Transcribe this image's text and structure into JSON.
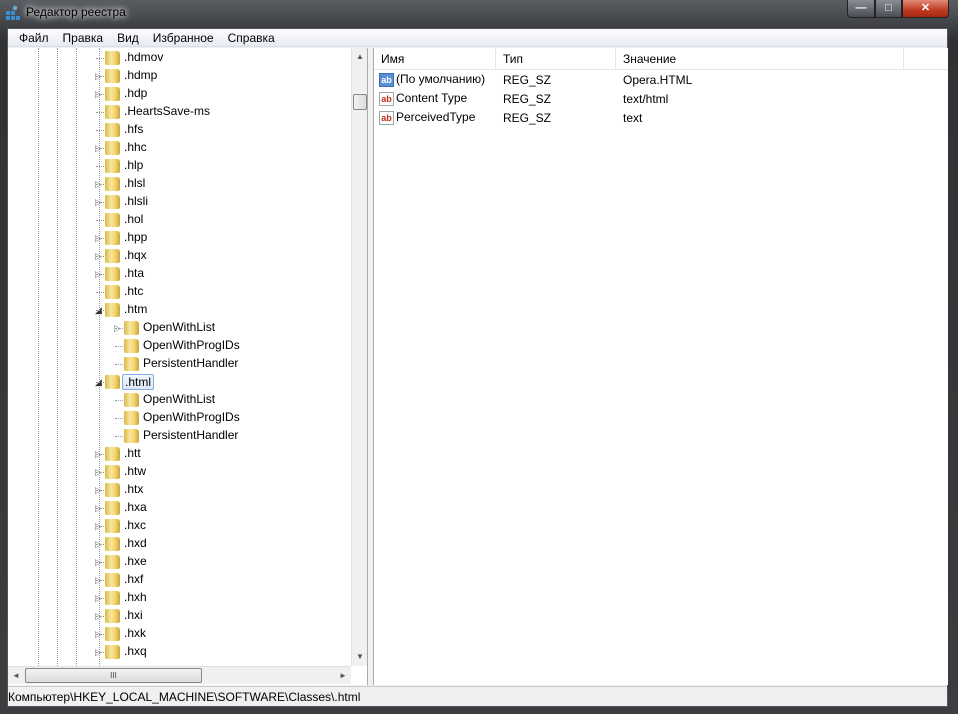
{
  "window": {
    "title": "Редактор реестра",
    "minimize": "—",
    "maximize": "□",
    "close": "✕"
  },
  "menu": [
    "Файл",
    "Правка",
    "Вид",
    "Избранное",
    "Справка"
  ],
  "tree": [
    {
      "label": ".hdmov",
      "level": 0,
      "arrow": "none"
    },
    {
      "label": ".hdmp",
      "level": 0,
      "arrow": "collapsed"
    },
    {
      "label": ".hdp",
      "level": 0,
      "arrow": "collapsed"
    },
    {
      "label": ".HeartsSave-ms",
      "level": 0,
      "arrow": "none"
    },
    {
      "label": ".hfs",
      "level": 0,
      "arrow": "none"
    },
    {
      "label": ".hhc",
      "level": 0,
      "arrow": "collapsed"
    },
    {
      "label": ".hlp",
      "level": 0,
      "arrow": "none"
    },
    {
      "label": ".hlsl",
      "level": 0,
      "arrow": "collapsed"
    },
    {
      "label": ".hlsli",
      "level": 0,
      "arrow": "collapsed"
    },
    {
      "label": ".hol",
      "level": 0,
      "arrow": "none"
    },
    {
      "label": ".hpp",
      "level": 0,
      "arrow": "collapsed"
    },
    {
      "label": ".hqx",
      "level": 0,
      "arrow": "collapsed"
    },
    {
      "label": ".hta",
      "level": 0,
      "arrow": "collapsed"
    },
    {
      "label": ".htc",
      "level": 0,
      "arrow": "none"
    },
    {
      "label": ".htm",
      "level": 0,
      "arrow": "expanded"
    },
    {
      "label": "OpenWithList",
      "level": 1,
      "arrow": "collapsed"
    },
    {
      "label": "OpenWithProgIDs",
      "level": 1,
      "arrow": "none"
    },
    {
      "label": "PersistentHandler",
      "level": 1,
      "arrow": "none"
    },
    {
      "label": ".html",
      "level": 0,
      "arrow": "expanded",
      "selected": true
    },
    {
      "label": "OpenWithList",
      "level": 1,
      "arrow": "none"
    },
    {
      "label": "OpenWithProgIDs",
      "level": 1,
      "arrow": "none"
    },
    {
      "label": "PersistentHandler",
      "level": 1,
      "arrow": "none"
    },
    {
      "label": ".htt",
      "level": 0,
      "arrow": "collapsed"
    },
    {
      "label": ".htw",
      "level": 0,
      "arrow": "collapsed"
    },
    {
      "label": ".htx",
      "level": 0,
      "arrow": "collapsed"
    },
    {
      "label": ".hxa",
      "level": 0,
      "arrow": "collapsed"
    },
    {
      "label": ".hxc",
      "level": 0,
      "arrow": "collapsed"
    },
    {
      "label": ".hxd",
      "level": 0,
      "arrow": "collapsed"
    },
    {
      "label": ".hxe",
      "level": 0,
      "arrow": "collapsed"
    },
    {
      "label": ".hxf",
      "level": 0,
      "arrow": "collapsed"
    },
    {
      "label": ".hxh",
      "level": 0,
      "arrow": "collapsed"
    },
    {
      "label": ".hxi",
      "level": 0,
      "arrow": "collapsed"
    },
    {
      "label": ".hxk",
      "level": 0,
      "arrow": "collapsed"
    },
    {
      "label": ".hxq",
      "level": 0,
      "arrow": "collapsed"
    }
  ],
  "scroll": {
    "up": "▲",
    "down": "▼",
    "left": "◄",
    "right": "►",
    "grip": "III"
  },
  "list": {
    "columns": [
      "Имя",
      "Тип",
      "Значение"
    ],
    "rows": [
      {
        "name": "(По умолчанию)",
        "type": "REG_SZ",
        "value": "Opera.HTML",
        "icon": "ab",
        "default": true
      },
      {
        "name": "Content Type",
        "type": "REG_SZ",
        "value": "text/html",
        "icon": "ab"
      },
      {
        "name": "PerceivedType",
        "type": "REG_SZ",
        "value": "text",
        "icon": "ab"
      }
    ]
  },
  "status": "Компьютер\\HKEY_LOCAL_MACHINE\\SOFTWARE\\Classes\\.html"
}
